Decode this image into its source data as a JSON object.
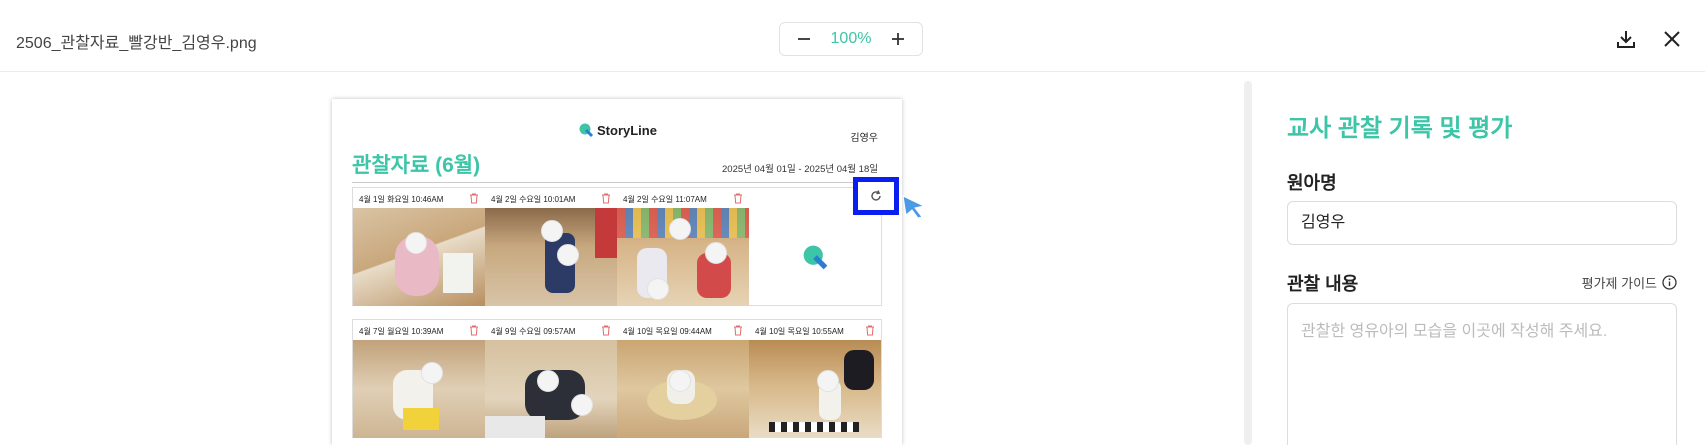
{
  "header": {
    "filename": "2506_관찰자료_빨강반_김영우.png",
    "zoom": "100%",
    "zoom_out_icon": "minus-icon",
    "zoom_in_icon": "plus-icon",
    "download_icon": "download-icon",
    "close_icon": "close-icon"
  },
  "document": {
    "logo_text": "StoryLine",
    "child_name": "김영우",
    "title": "관찰자료 (6월)",
    "date_range": "2025년 04월 01일 - 2025년 04월 18일",
    "rows": [
      {
        "captions": [
          "4월 1일 화요일 10:46AM",
          "4월 2일 수요일 10:01AM",
          "4월 2일 수요일 11:07AM",
          ""
        ]
      },
      {
        "captions": [
          "4월 7일 월요일 10:39AM",
          "4월 9일 수요일 09:57AM",
          "4월 10일 목요일 09:44AM",
          "4월 10일 목요일 10:55AM"
        ]
      }
    ],
    "refresh_icon": "refresh-icon"
  },
  "panel": {
    "title": "교사 관찰 기록 및 평가",
    "name_label": "원아명",
    "name_value": "김영우",
    "content_label": "관찰 내용",
    "guide_label": "평가제 가이드",
    "guide_icon": "info-icon",
    "content_placeholder": "관찰한 영유아의 모습을 이곳에 작성해 주세요."
  },
  "colors": {
    "accent": "#3cc5a6",
    "highlight": "#0a1ef0",
    "trash": "#e26b6b"
  }
}
